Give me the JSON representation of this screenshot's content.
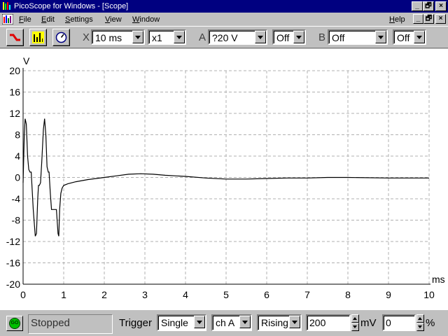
{
  "window": {
    "title": "PicoScope for Windows - [Scope]",
    "minimize_glyph": "_",
    "restore_glyph": "🗗",
    "close_glyph": "×"
  },
  "menu": {
    "items": [
      {
        "label": "File",
        "accel": "F",
        "rest": "ile"
      },
      {
        "label": "Edit",
        "accel": "E",
        "rest": "dit"
      },
      {
        "label": "Settings",
        "accel": "S",
        "rest": "ettings"
      },
      {
        "label": "View",
        "accel": "V",
        "rest": "iew"
      },
      {
        "label": "Window",
        "accel": "W",
        "rest": "indow"
      }
    ],
    "help": {
      "label": "Help",
      "accel": "H",
      "rest": "elp"
    }
  },
  "toolbar": {
    "x_label": "X",
    "timebase": "10 ms",
    "multiplier": "x1",
    "a_label": "A",
    "a_range": "?20 V",
    "a_coupling": "Off",
    "b_label": "B",
    "b_range": "Off",
    "b_coupling": "Off",
    "icons": [
      "scope-icon",
      "spectrum-icon",
      "meter-icon"
    ]
  },
  "chart_data": {
    "type": "line",
    "ylabel": "V",
    "xlabel": "ms",
    "xlim": [
      0,
      10
    ],
    "ylim": [
      -20,
      20
    ],
    "grid": true,
    "x_ticks": [
      0,
      1,
      2,
      3,
      4,
      5,
      6,
      7,
      8,
      9,
      10
    ],
    "y_ticks": [
      20,
      16,
      12,
      8,
      4,
      0,
      -4,
      -8,
      -12,
      -16,
      -20
    ],
    "series": [
      {
        "color": "#000000",
        "x": [
          0.0,
          0.03,
          0.05,
          0.08,
          0.11,
          0.14,
          0.17,
          0.2,
          0.25,
          0.3,
          0.33,
          0.36,
          0.38,
          0.4,
          0.43,
          0.46,
          0.5,
          0.53,
          0.56,
          0.59,
          0.62,
          0.64,
          0.67,
          0.7,
          0.74,
          0.78,
          0.82,
          0.86,
          0.88,
          0.9,
          0.93,
          0.96,
          1.0,
          1.1,
          1.3,
          1.6,
          2.0,
          2.3,
          2.6,
          2.9,
          3.2,
          3.5,
          4.0,
          4.5,
          5.0,
          5.5,
          6.0,
          6.5,
          7.0,
          7.5,
          8.0,
          9.0,
          10.0
        ],
        "y": [
          -1.0,
          8.0,
          11.0,
          10.0,
          4.0,
          1.5,
          1.0,
          1.0,
          -6.0,
          -11.0,
          -10.5,
          -4.0,
          -1.5,
          -1.5,
          -1.0,
          3.0,
          9.0,
          11.0,
          8.0,
          2.0,
          1.0,
          1.0,
          -3.0,
          -6.0,
          -6.0,
          -6.0,
          -6.0,
          -10.5,
          -11.0,
          -6.0,
          -3.0,
          -2.0,
          -1.5,
          -1.2,
          -0.8,
          -0.4,
          0.0,
          0.3,
          0.6,
          0.7,
          0.6,
          0.4,
          0.2,
          -0.1,
          -0.3,
          -0.3,
          -0.2,
          -0.1,
          -0.1,
          0.0,
          0.0,
          -0.1,
          -0.1
        ]
      }
    ]
  },
  "status": {
    "go_label": "GO",
    "state": "Stopped",
    "trigger_label": "Trigger",
    "trigger_mode": "Single",
    "trigger_channel": "ch A",
    "trigger_edge": "Rising",
    "trigger_level": "200",
    "trigger_level_unit": "mV",
    "pre_trigger": "0",
    "pre_trigger_unit": "%"
  }
}
